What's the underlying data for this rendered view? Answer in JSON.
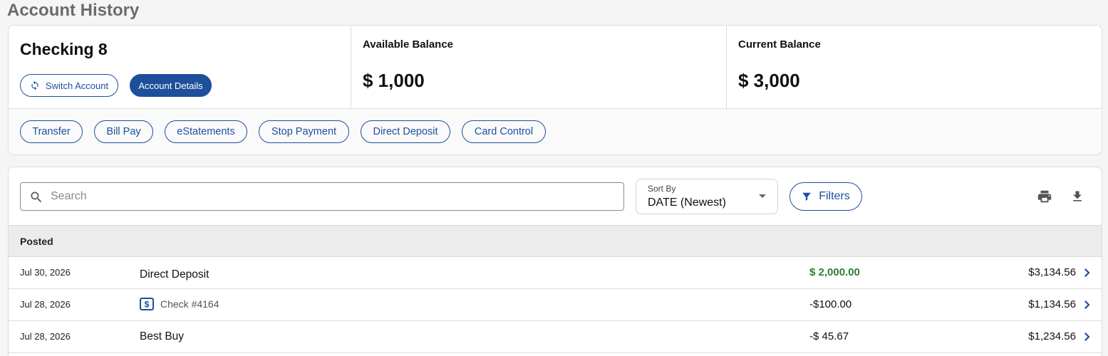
{
  "page": {
    "title": "Account History"
  },
  "account": {
    "name": "Checking 8",
    "switch_label": "Switch Account",
    "details_label": "Account Details",
    "available_label": "Available Balance",
    "available_value": "$ 1,000",
    "current_label": "Current Balance",
    "current_value": "$ 3,000"
  },
  "actions": [
    {
      "label": "Transfer"
    },
    {
      "label": "Bill Pay"
    },
    {
      "label": "eStatements"
    },
    {
      "label": "Stop Payment"
    },
    {
      "label": "Direct Deposit"
    },
    {
      "label": "Card Control"
    }
  ],
  "toolbar": {
    "search_placeholder": "Search",
    "sort_label": "Sort By",
    "sort_value": "DATE (Newest)",
    "filters_label": "Filters"
  },
  "section": {
    "title": "Posted"
  },
  "transactions": [
    {
      "date": "Jul 30, 2026",
      "description": "Direct Deposit",
      "amount": "$ 2,000.00",
      "balance": "$3,134.56"
    },
    {
      "date": "Jul 28, 2026",
      "description": "Check #4164",
      "amount": "-$100.00",
      "balance": "$1,134.56"
    },
    {
      "date": "Jul 28, 2026",
      "description": "Best Buy",
      "amount": "-$ 45.67",
      "balance": "$1,234.56"
    }
  ],
  "colors": {
    "brand": "#1d4f9a",
    "credit": "#2e7d32",
    "muted_title": "#6b6b6b"
  },
  "icons": [
    "refresh-icon",
    "search-icon",
    "chevron-down-icon",
    "filter-icon",
    "print-icon",
    "download-icon",
    "check-icon",
    "chevron-right-icon"
  ]
}
